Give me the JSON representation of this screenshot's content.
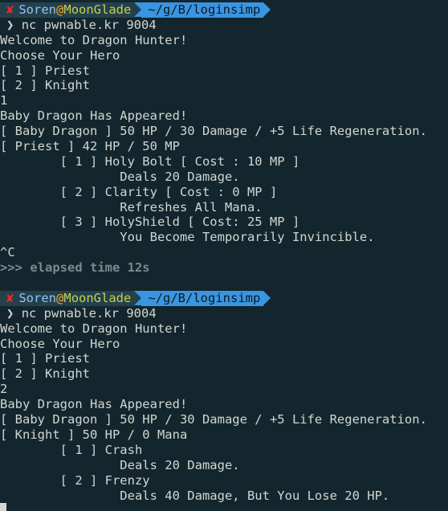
{
  "colors": {
    "background": "#13262e",
    "text": "#d3d7cf",
    "prompt_user_bg": "#25404b",
    "prompt_path_bg": "#3a95e0",
    "error_mark": "#ef2929",
    "user": "#8ec4f7",
    "at": "#f5a623",
    "host": "#c4d24e",
    "elapsed": "#7c8a8e"
  },
  "icons": {
    "error_mark": "✘",
    "prompt_chevron": "❯"
  },
  "blocks": [
    {
      "prompt": {
        "user": "Soren",
        "at": "@",
        "host": "MoonGlade",
        "path": "~/g/B/loginsimp"
      },
      "command": "nc pwnable.kr 9004",
      "output": [
        "Welcome to Dragon Hunter!",
        "Choose Your Hero",
        "[ 1 ] Priest",
        "[ 2 ] Knight",
        "1",
        "Baby Dragon Has Appeared!",
        "[ Baby Dragon ] 50 HP / 30 Damage / +5 Life Regeneration.",
        "[ Priest ] 42 HP / 50 MP",
        "        [ 1 ] Holy Bolt [ Cost : 10 MP ]",
        "                Deals 20 Damage.",
        "        [ 2 ] Clarity [ Cost : 0 MP ]",
        "                Refreshes All Mana.",
        "        [ 3 ] HolyShield [ Cost: 25 MP ]",
        "                You Become Temporarily Invincible.",
        "^C"
      ],
      "elapsed": ">>> elapsed time 12s"
    },
    {
      "prompt": {
        "user": "Soren",
        "at": "@",
        "host": "MoonGlade",
        "path": "~/g/B/loginsimp"
      },
      "command": "nc pwnable.kr 9004",
      "output": [
        "Welcome to Dragon Hunter!",
        "Choose Your Hero",
        "[ 1 ] Priest",
        "[ 2 ] Knight",
        "2",
        "Baby Dragon Has Appeared!",
        "[ Baby Dragon ] 50 HP / 30 Damage / +5 Life Regeneration.",
        "[ Knight ] 50 HP / 0 Mana",
        "        [ 1 ] Crash",
        "                Deals 20 Damage.",
        "        [ 2 ] Frenzy",
        "                Deals 40 Damage, But You Lose 20 HP."
      ]
    }
  ]
}
